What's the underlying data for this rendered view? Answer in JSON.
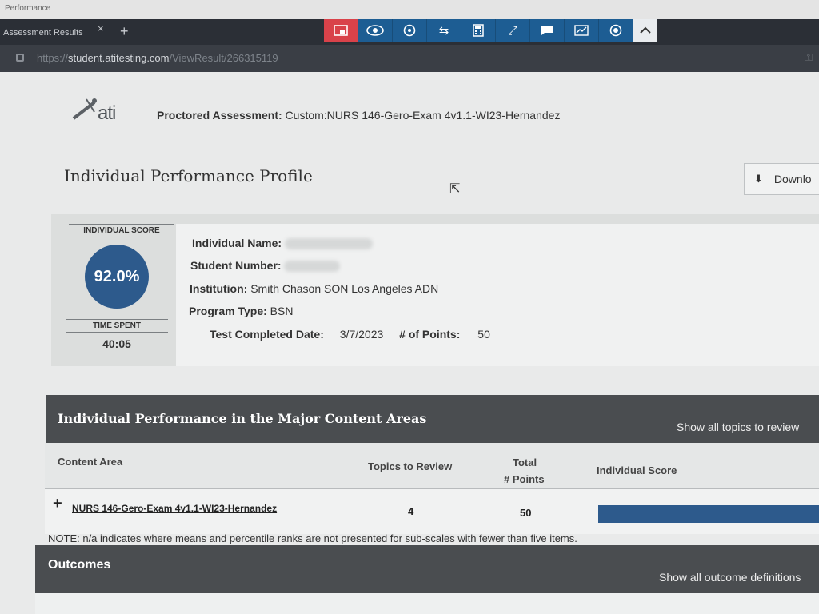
{
  "window": {
    "title": "Performance"
  },
  "tab": {
    "label": "Assessment Results",
    "close": "×",
    "new": "+"
  },
  "toolbar": {
    "icons": [
      "screenshot-icon",
      "eye-icon",
      "tools-icon",
      "swap-icon",
      "calculator-icon",
      "fullscreen-icon",
      "chat-icon",
      "chart-icon",
      "record-icon",
      "chevron-up-icon"
    ],
    "colors": {
      "bar": "#1d5d93",
      "active": "#d9424a"
    }
  },
  "address": {
    "protocol": "https://",
    "host": "student.atitesting.com",
    "path": "/ViewResult/266315119"
  },
  "header": {
    "logo_text": "ati",
    "assessment_label": "Proctored Assessment:",
    "assessment_name": "Custom:NURS 146-Gero-Exam 4v1.1-WI23-Hernandez"
  },
  "profile": {
    "title": "Individual Performance Profile",
    "download_label": "Downlo"
  },
  "score": {
    "score_label": "INDIVIDUAL SCORE",
    "score_value": "92.0%",
    "time_label": "TIME SPENT",
    "time_value": "40:05",
    "color": "#2d5a8c"
  },
  "info": {
    "name_label": "Individual Name:",
    "student_number_label": "Student Number:",
    "institution_label": "Institution:",
    "institution_value": "Smith Chason SON Los Angeles ADN",
    "program_label": "Program Type:",
    "program_value": "BSN",
    "date_label": "Test Completed Date:",
    "date_value": "3/7/2023",
    "points_label": "# of Points:",
    "points_value": "50"
  },
  "content_areas": {
    "title": "Individual Performance in the Major Content Areas",
    "show_link": "Show all topics to review",
    "columns": {
      "content_area": "Content Area",
      "topics": "Topics to Review",
      "total_line1": "Total",
      "total_line2": "# Points",
      "score": "Individual Score"
    },
    "rows": [
      {
        "expand": "+",
        "name": "NURS 146-Gero-Exam 4v1.1-WI23-Hernandez",
        "topics": "4",
        "points": "50",
        "score_pct": 92.0
      }
    ],
    "note": "NOTE: n/a indicates where means and percentile ranks are not presented for sub-scales with fewer than five items."
  },
  "outcomes": {
    "title": "Outcomes",
    "show_link": "Show all outcome definitions"
  }
}
